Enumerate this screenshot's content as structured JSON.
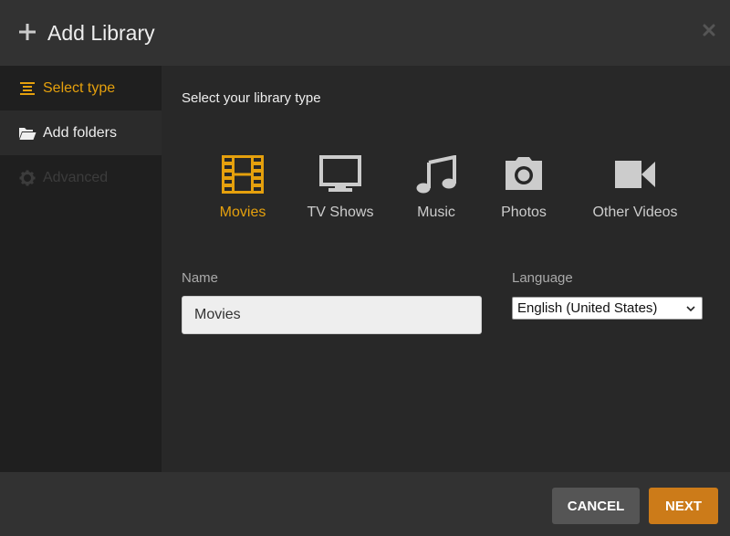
{
  "header": {
    "title": "Add Library",
    "plus_icon": "plus-icon",
    "close_icon": "close-icon"
  },
  "sidebar": {
    "items": [
      {
        "label": "Select type",
        "icon": "list-icon",
        "state": "active"
      },
      {
        "label": "Add folders",
        "icon": "folder-open-icon",
        "state": "normal"
      },
      {
        "label": "Advanced",
        "icon": "gear-icon",
        "state": "disabled"
      }
    ]
  },
  "main": {
    "prompt": "Select your library type",
    "types": [
      {
        "label": "Movies",
        "icon": "film-icon",
        "selected": true
      },
      {
        "label": "TV Shows",
        "icon": "tv-icon",
        "selected": false
      },
      {
        "label": "Music",
        "icon": "music-note-icon",
        "selected": false
      },
      {
        "label": "Photos",
        "icon": "camera-icon",
        "selected": false
      },
      {
        "label": "Other Videos",
        "icon": "video-camera-icon",
        "selected": false
      }
    ],
    "name_label": "Name",
    "name_value": "Movies",
    "language_label": "Language",
    "language_value": "English (United States)"
  },
  "footer": {
    "cancel_label": "CANCEL",
    "next_label": "NEXT"
  },
  "colors": {
    "accent": "#e5a00d",
    "next_button": "#cc7b19",
    "cancel_button": "#555555",
    "icon_gray": "#cccccc"
  }
}
